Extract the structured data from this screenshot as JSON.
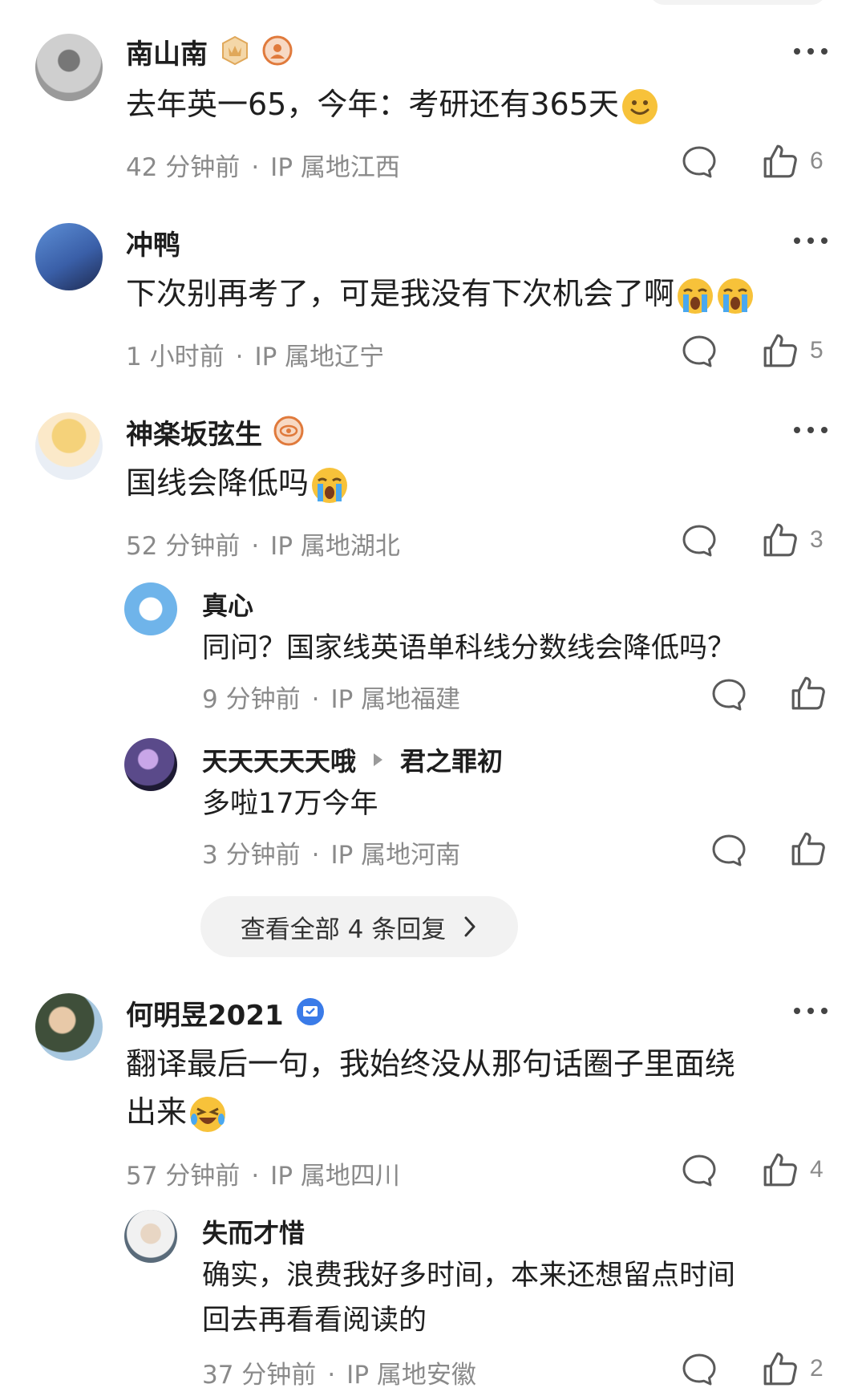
{
  "comments": [
    {
      "username": "南山南",
      "text": "去年英一65，今年：考研还有365天",
      "emoji": "smile-emoji",
      "time": "42 分钟前",
      "ip": "IP 属地江西",
      "likes": "6"
    },
    {
      "username": "冲鸭",
      "text": "下次别再考了，可是我没有下次机会了啊",
      "emoji": "crying-emoji",
      "time": "1 小时前",
      "ip": "IP 属地辽宁",
      "likes": "5"
    },
    {
      "username": "神楽坂弦生",
      "text": "国线会降低吗",
      "emoji": "crying-emoji",
      "time": "52 分钟前",
      "ip": "IP 属地湖北",
      "likes": "3",
      "replies": [
        {
          "username": "真心",
          "text": "同问？国家线英语单科线分数线会降低吗？",
          "time": "9 分钟前",
          "ip": "IP 属地福建"
        },
        {
          "username": "天天天天天哦",
          "reply_to": "君之罪初",
          "text": "多啦17万今年",
          "time": "3 分钟前",
          "ip": "IP 属地河南"
        }
      ],
      "view_all": "查看全部 4 条回复"
    },
    {
      "username": "何明昱2021",
      "text_line1": "翻译最后一句，我始终没从那句话圈子里面绕",
      "text_line2": "出来",
      "emoji": "laugh-cry-emoji",
      "time": "57 分钟前",
      "ip": "IP 属地四川",
      "likes": "4",
      "replies": [
        {
          "username": "失而才惜",
          "text_line1": "确实，浪费我好多时间，本来还想留点时间",
          "text_line2": "回去再看看阅读的",
          "time": "37 分钟前",
          "ip": "IP 属地安徽",
          "likes": "2"
        }
      ]
    }
  ],
  "meta_separator": "·",
  "colors": {
    "text": "#1f1f1f",
    "meta": "#8a8a8a",
    "badge_gold": "#e0a85a",
    "badge_orange": "#e07a3c",
    "badge_blue": "#3a7be8"
  }
}
